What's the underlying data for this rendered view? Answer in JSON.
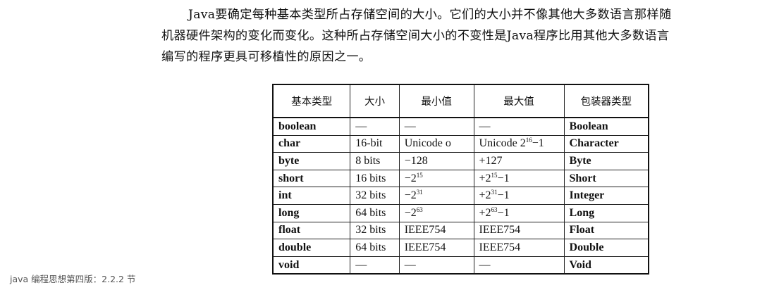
{
  "paragraph": {
    "line1": "Java要确定每种基本类型所占存储空间的大小。它们的大小并不像其他大多数语言那样随",
    "line2": "机器硬件架构的变化而变化。这种所占存储空间大小的不变性是Java程序比用其他大多数语言",
    "line3": "编写的程序更具可移植性的原因之一。"
  },
  "table": {
    "headers": [
      "基本类型",
      "大小",
      "最小值",
      "最大值",
      "包装器类型"
    ],
    "rows": [
      {
        "type": "boolean",
        "size": "—",
        "min_base": "—",
        "min_exp": "",
        "min_tail": "",
        "max_base": "—",
        "max_exp": "",
        "max_tail": "",
        "wrapper": "Boolean"
      },
      {
        "type": "char",
        "size": "16-bit",
        "min_base": "Unicode o",
        "min_exp": "",
        "min_tail": "",
        "max_base": "Unicode 2",
        "max_exp": "16",
        "max_tail": "−1",
        "wrapper": "Character"
      },
      {
        "type": "byte",
        "size": "8 bits",
        "min_base": "−128",
        "min_exp": "",
        "min_tail": "",
        "max_base": "+127",
        "max_exp": "",
        "max_tail": "",
        "wrapper": "Byte"
      },
      {
        "type": "short",
        "size": "16 bits",
        "min_base": "−2",
        "min_exp": "15",
        "min_tail": "",
        "max_base": "+2",
        "max_exp": "15",
        "max_tail": "−1",
        "wrapper": "Short"
      },
      {
        "type": "int",
        "size": "32 bits",
        "min_base": "−2",
        "min_exp": "31",
        "min_tail": "",
        "max_base": "+2",
        "max_exp": "31",
        "max_tail": "−1",
        "wrapper": "Integer"
      },
      {
        "type": "long",
        "size": "64 bits",
        "min_base": "−2",
        "min_exp": "63",
        "min_tail": "",
        "max_base": "+2",
        "max_exp": "63",
        "max_tail": "−1",
        "wrapper": "Long"
      },
      {
        "type": "float",
        "size": "32 bits",
        "min_base": "IEEE754",
        "min_exp": "",
        "min_tail": "",
        "max_base": "IEEE754",
        "max_exp": "",
        "max_tail": "",
        "wrapper": "Float"
      },
      {
        "type": "double",
        "size": "64 bits",
        "min_base": "IEEE754",
        "min_exp": "",
        "min_tail": "",
        "max_base": "IEEE754",
        "max_exp": "",
        "max_tail": "",
        "wrapper": "Double"
      },
      {
        "type": "void",
        "size": "—",
        "min_base": "—",
        "min_exp": "",
        "min_tail": "",
        "max_base": "—",
        "max_exp": "",
        "max_tail": "",
        "wrapper": "Void"
      }
    ]
  },
  "caption": "java 编程思想第四版：2.2.2 节"
}
